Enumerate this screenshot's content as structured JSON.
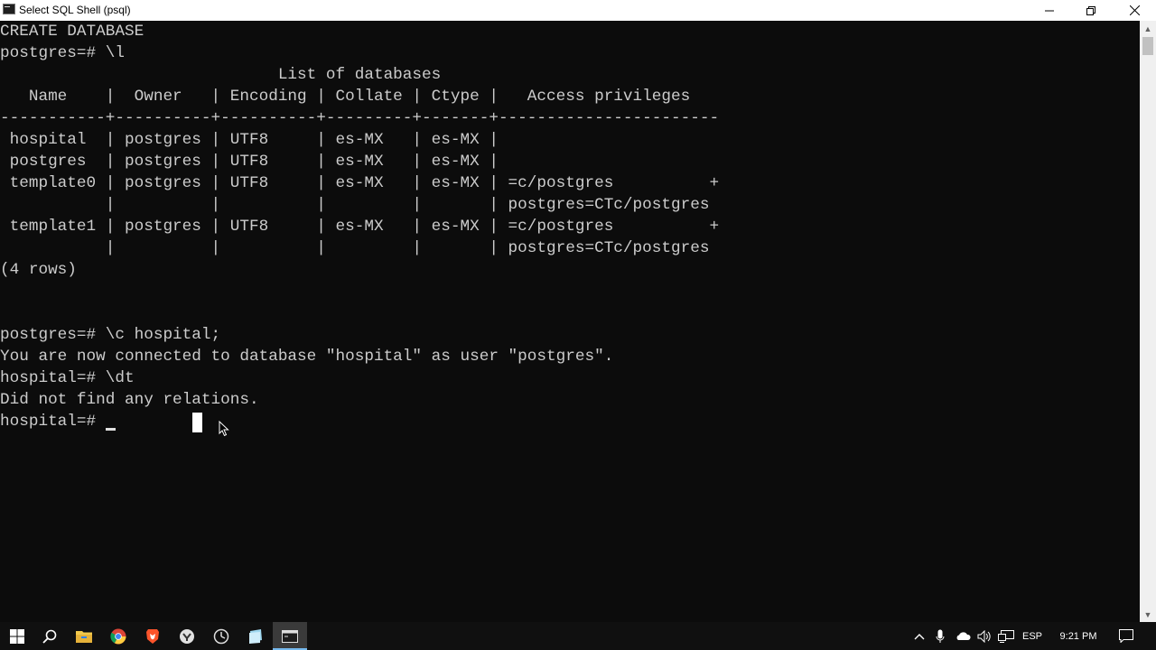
{
  "window": {
    "title": "Select SQL Shell (psql)",
    "minimize_glyph": "─",
    "maximize_glyph": "❐",
    "close_glyph": "✕"
  },
  "console": {
    "lines": [
      "CREATE DATABASE",
      "postgres=# \\l",
      "                             List of databases",
      "   Name    |  Owner   | Encoding | Collate | Ctype |   Access privileges",
      "-----------+----------+----------+---------+-------+-----------------------",
      " hospital  | postgres | UTF8     | es-MX   | es-MX |",
      " postgres  | postgres | UTF8     | es-MX   | es-MX |",
      " template0 | postgres | UTF8     | es-MX   | es-MX | =c/postgres          +",
      "           |          |          |         |       | postgres=CTc/postgres",
      " template1 | postgres | UTF8     | es-MX   | es-MX | =c/postgres          +",
      "           |          |          |         |       | postgres=CTc/postgres",
      "(4 rows)",
      "",
      "",
      "postgres=# \\c hospital;",
      "You are now connected to database \"hospital\" as user \"postgres\".",
      "hospital=# \\dt",
      "Did not find any relations.",
      "hospital=# "
    ]
  },
  "taskbar": {
    "icons": [
      "windows-start-icon",
      "search-icon",
      "file-explorer-icon",
      "chrome-icon",
      "brave-icon",
      "app-icon-shield",
      "clock-app-icon",
      "notes-app-icon",
      "terminal-icon"
    ],
    "tray": {
      "language": "ESP",
      "time": "9:21 PM"
    }
  },
  "colors": {
    "console_bg": "#0c0c0c",
    "console_text": "#cccccc",
    "taskbar_bg": "#101010",
    "active_indicator": "#76b9ed"
  }
}
